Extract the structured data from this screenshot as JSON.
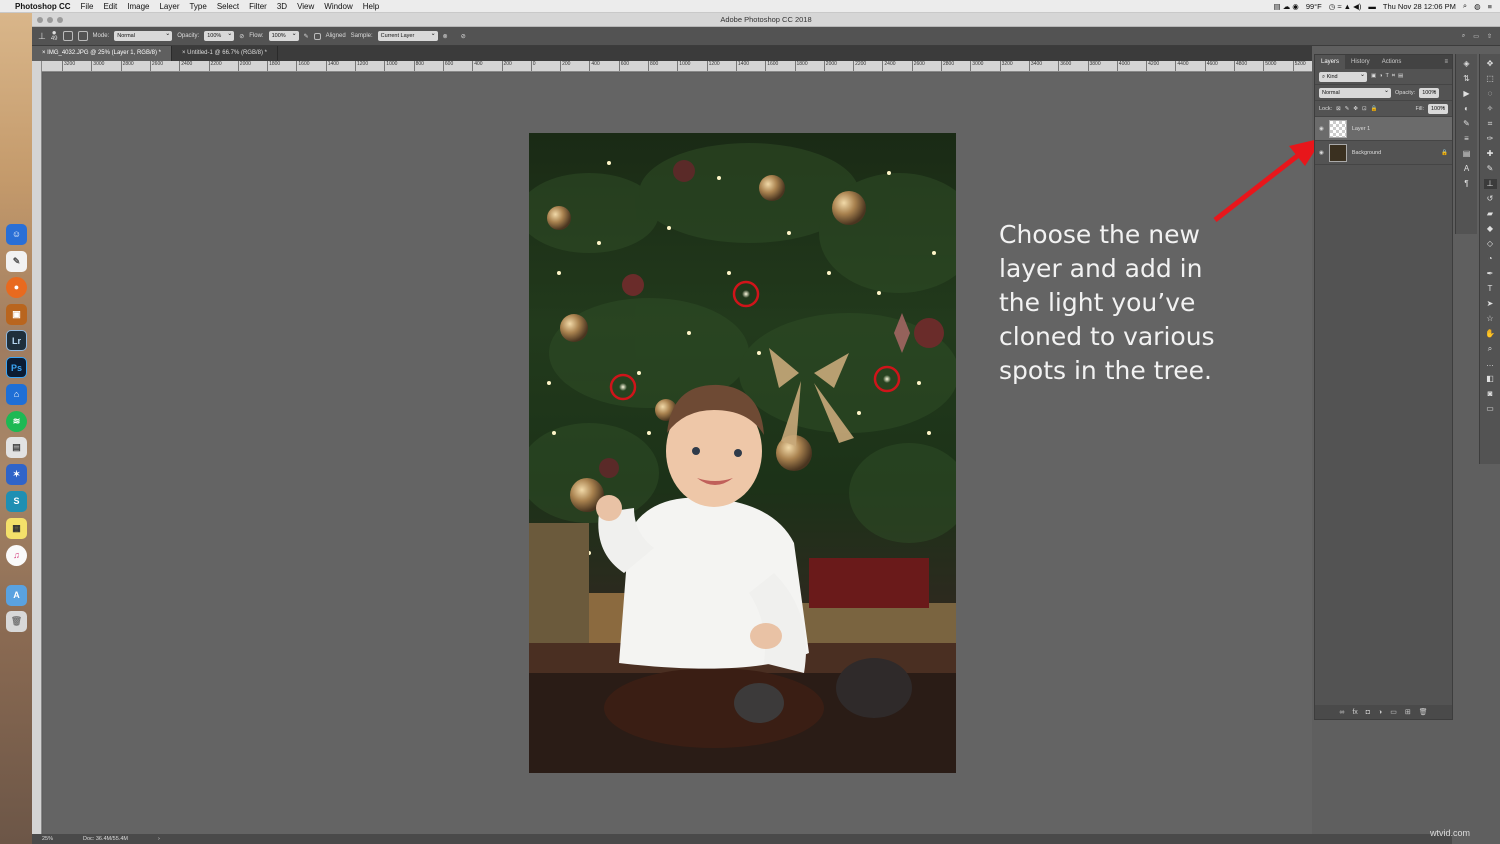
{
  "menubar": {
    "app_name": "Photoshop CC",
    "items": [
      "File",
      "Edit",
      "Image",
      "Layer",
      "Type",
      "Select",
      "Filter",
      "3D",
      "View",
      "Window",
      "Help"
    ],
    "weather": "99°F",
    "clock": "Thu Nov 28  12:06 PM"
  },
  "window": {
    "title": "Adobe Photoshop CC 2018"
  },
  "options": {
    "brush_size": "49",
    "mode_label": "Mode:",
    "mode_value": "Normal",
    "opacity_label": "Opacity:",
    "opacity_value": "100%",
    "flow_label": "Flow:",
    "flow_value": "100%",
    "aligned_label": "Aligned",
    "sample_label": "Sample:",
    "sample_value": "Current Layer"
  },
  "tabs": [
    {
      "label": "IMG_4032.JPG @ 25% (Layer 1, RGB/8) *"
    },
    {
      "label": "Untitled-1 @ 66.7% (RGB/8) *"
    }
  ],
  "ruler_labels": [
    "3200",
    "3000",
    "2800",
    "2600",
    "2400",
    "2200",
    "2000",
    "1800",
    "1600",
    "1400",
    "1200",
    "1000",
    "800",
    "600",
    "400",
    "200",
    "0",
    "200",
    "400",
    "600",
    "800",
    "1000",
    "1200",
    "1400",
    "1600",
    "1800",
    "2000",
    "2200",
    "2400",
    "2600",
    "2800",
    "3000",
    "3200",
    "3400",
    "3600",
    "3800",
    "4000",
    "4200",
    "4400",
    "4600",
    "4800",
    "5000",
    "5200"
  ],
  "status": {
    "zoom": "25%",
    "doc": "Doc: 36.4M/55.4M"
  },
  "panel": {
    "tabs": [
      "Layers",
      "History",
      "Actions"
    ],
    "kind_label": "Kind",
    "blend_mode": "Normal",
    "opacity_label": "Opacity:",
    "opacity_value": "100%",
    "lock_label": "Lock:",
    "fill_label": "Fill:",
    "fill_value": "100%",
    "layers": [
      {
        "name": "Layer 1",
        "selected": true
      },
      {
        "name": "Background",
        "locked": true
      }
    ]
  },
  "annotation": {
    "lines": [
      "Choose the new",
      "layer and add in",
      "the light you’ve",
      "cloned to various",
      "spots in the tree."
    ],
    "arrow_color": "#e8161b",
    "circle_color": "#d0141a"
  },
  "dock": {
    "lr_label": "Lr",
    "ps_label": "Ps"
  },
  "watermark": "wtvid.com"
}
